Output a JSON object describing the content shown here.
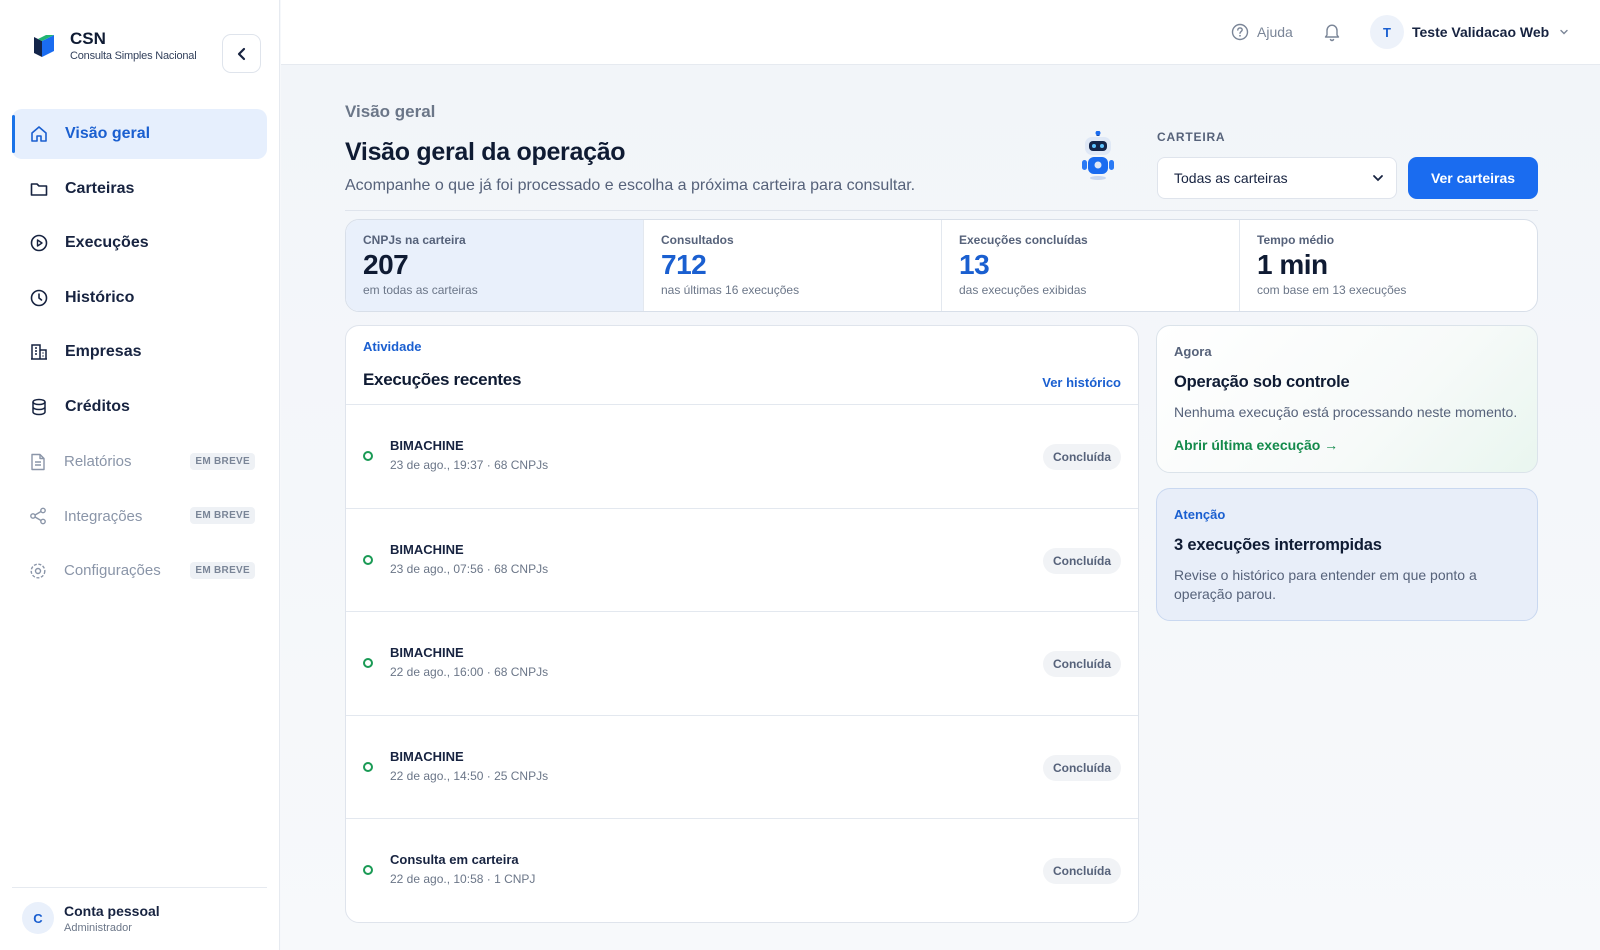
{
  "brand": {
    "name": "CSN",
    "subtitle": "Consulta Simples Nacional"
  },
  "sidebar": {
    "items": [
      {
        "label": "Visão geral",
        "icon": "home-icon",
        "active": true
      },
      {
        "label": "Carteiras",
        "icon": "folder-icon"
      },
      {
        "label": "Execuções",
        "icon": "play-circle-icon"
      },
      {
        "label": "Histórico",
        "icon": "clock-icon"
      },
      {
        "label": "Empresas",
        "icon": "building-icon"
      },
      {
        "label": "Créditos",
        "icon": "database-icon"
      },
      {
        "label": "Relatórios",
        "icon": "document-icon",
        "badge": "EM BREVE"
      },
      {
        "label": "Integrações",
        "icon": "share-icon",
        "badge": "EM BREVE"
      },
      {
        "label": "Configurações",
        "icon": "gear-icon",
        "badge": "EM BREVE"
      }
    ],
    "account": {
      "initial": "C",
      "name": "Conta pessoal",
      "role": "Administrador"
    }
  },
  "topbar": {
    "help_label": "Ajuda",
    "user": {
      "initial": "T",
      "name": "Teste Validacao Web"
    }
  },
  "header": {
    "breadcrumb": "Visão geral",
    "title": "Visão geral da operação",
    "subtitle": "Acompanhe o que já foi processado e escolha a próxima carteira para consultar.",
    "wallet_label": "CARTEIRA",
    "wallet_selected": "Todas as carteiras",
    "wallet_button": "Ver carteiras"
  },
  "stats": [
    {
      "label": "CNPJs na carteira",
      "value": "207",
      "note": "em todas as carteiras"
    },
    {
      "label": "Consultados",
      "value": "712",
      "note": "nas últimas 16 execuções"
    },
    {
      "label": "Execuções concluídas",
      "value": "13",
      "note": "das execuções exibidas"
    },
    {
      "label": "Tempo médio",
      "value": "1 min",
      "note": "com base em 13 execuções"
    }
  ],
  "activity": {
    "kicker": "Atividade",
    "title": "Execuções recentes",
    "link": "Ver histórico",
    "rows": [
      {
        "title": "BIMACHINE",
        "meta": "23 de ago., 19:37 · 68 CNPJs",
        "status": "Concluída"
      },
      {
        "title": "BIMACHINE",
        "meta": "23 de ago., 07:56 · 68 CNPJs",
        "status": "Concluída"
      },
      {
        "title": "BIMACHINE",
        "meta": "22 de ago., 16:00 · 68 CNPJs",
        "status": "Concluída"
      },
      {
        "title": "BIMACHINE",
        "meta": "22 de ago., 14:50 · 25 CNPJs",
        "status": "Concluída"
      },
      {
        "title": "Consulta em carteira",
        "meta": "22 de ago., 10:58 · 1 CNPJ",
        "status": "Concluída"
      }
    ]
  },
  "now_card": {
    "kicker": "Agora",
    "title": "Operação sob controle",
    "text": "Nenhuma execução está processando neste momento.",
    "link": "Abrir última execução →"
  },
  "warn_card": {
    "kicker": "Atenção",
    "title": "3 execuções interrompidas",
    "text": "Revise o histórico para entender em que ponto a operação parou."
  },
  "colors": {
    "accent": "#1a6cf0",
    "success": "#138a4b",
    "active_bg": "#e6effd"
  }
}
